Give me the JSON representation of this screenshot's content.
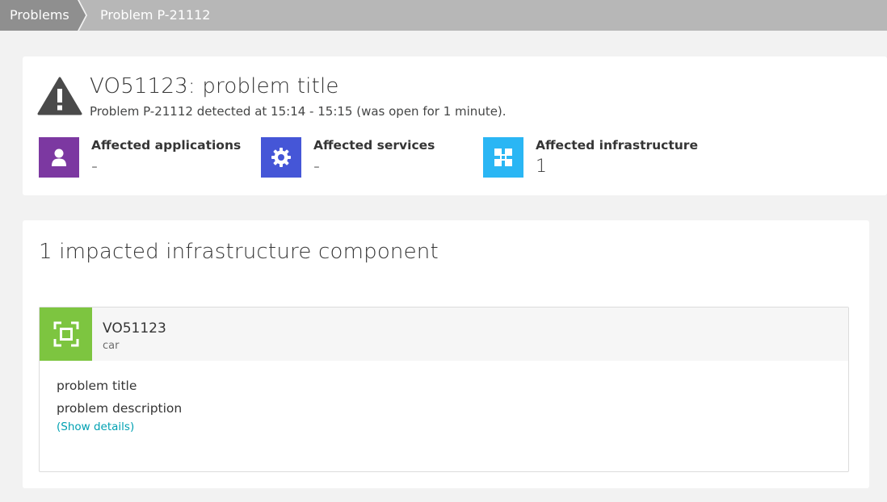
{
  "breadcrumb": {
    "items": [
      {
        "label": "Problems"
      },
      {
        "label": "Problem P-21112"
      }
    ]
  },
  "header": {
    "title": "VO51123: problem title",
    "subtitle": "Problem P-21112 detected at 15:14 - 15:15 (was open for 1 minute).",
    "icon": "warning-triangle-icon"
  },
  "affected": {
    "applications": {
      "label": "Affected applications",
      "value": "-",
      "color": "#7c38a1",
      "icon": "user-icon"
    },
    "services": {
      "label": "Affected services",
      "value": "-",
      "color": "#4556d7",
      "icon": "gear-icon"
    },
    "infrastructure": {
      "label": "Affected infrastructure",
      "value": "1",
      "color": "#2ab6f4",
      "icon": "host-icon"
    }
  },
  "impact": {
    "heading": "1 impacted infrastructure component",
    "component": {
      "name": "VO51123",
      "type": "car",
      "icon": "device-frame-icon",
      "icon_color": "#7dc540",
      "problem_title": "problem title",
      "problem_description": "problem description",
      "details_link": "(Show details)"
    }
  },
  "colors": {
    "breadcrumb_bg": "#b7b7b7",
    "breadcrumb_active": "#8f8f8f",
    "link": "#00a1b2"
  }
}
